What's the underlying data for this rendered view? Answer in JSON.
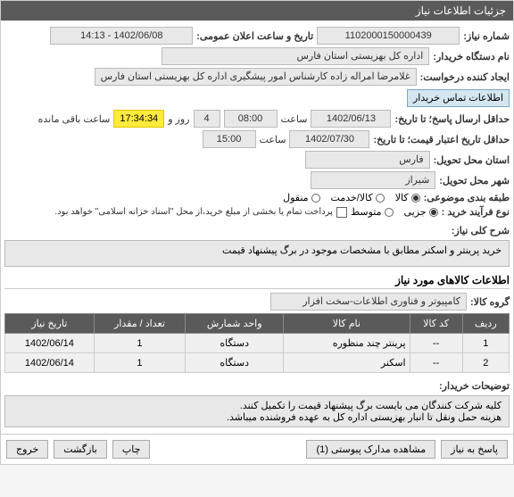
{
  "header": {
    "title": "جزئیات اطلاعات نیاز"
  },
  "fields": {
    "neednum_label": "شماره نیاز:",
    "neednum_value": "1102000150000439",
    "announce_label": "تاریخ و ساعت اعلان عمومی:",
    "announce_value": "1402/06/08 - 14:13",
    "buyerorg_label": "نام دستگاه خریدار:",
    "buyerorg_value": "اداره کل بهزیستی استان فارس",
    "requester_label": "ایجاد کننده درخواست:",
    "requester_value": "غلامرضا امراله زاده کارشناس امور پیشگیری اداره کل بهزیستی استان فارس",
    "contact_btn": "اطلاعات تماس خریدار",
    "deadline_label": "حداقل ارسال پاسخ؛ تا تاریخ:",
    "deadline_date": "1402/06/13",
    "time_label": "ساعت",
    "deadline_time": "08:00",
    "days_left": "4",
    "days_word": "روز و",
    "countdown": "17:34:34",
    "remaining": "ساعت باقی مانده",
    "validity_label": "حداقل تاریخ اعتبار قیمت؛ تا تاریخ:",
    "validity_date": "1402/07/30",
    "validity_time": "15:00",
    "province_label": "استان محل تحویل:",
    "province_value": "فارس",
    "city_label": "شهر محل تحویل:",
    "city_value": "شیراز",
    "category_label": "طبقه بندی موضوعی:",
    "cat_kala": "کالا",
    "cat_service": "کالا/خدمت",
    "cat_mix": "منقول",
    "process_label": "نوع فرآیند خرید :",
    "proc_partial": "جزیی",
    "proc_medium": "متوسط",
    "note_checkbox": "پرداخت تمام یا بخشی از مبلغ خرید،از محل \"اسناد خزانه اسلامی\" خواهد بود.",
    "maindesc_label": "شرح کلی نیاز:",
    "maindesc_value": "خرید پرینتر و اسکنر مطابق با مشخصات موجود در برگ پیشنهاد قیمت",
    "items_section": "اطلاعات کالاهای مورد نیاز",
    "grouplabel": "گروه کالا:",
    "groupvalue": "کامپیوتر و فناوری اطلاعات-سخت افزار",
    "buyernotes_label": "توضیحات خریدار:",
    "buyernotes_value": "کلیه شرکت کنندگان می بایست برگ پیشنهاد قیمت را تکمیل کنند.\nهزینه حمل ونقل تا انبار بهزیستی اداره کل به عهده فروشنده میباشد."
  },
  "table": {
    "headers": {
      "row": "ردیف",
      "code": "کد کالا",
      "name": "نام کالا",
      "unit": "واحد شمارش",
      "qty": "تعداد / مقدار",
      "date": "تاریخ نیاز"
    },
    "rows": [
      {
        "row": "1",
        "code": "--",
        "name": "پرینتر چند منظوره",
        "unit": "دستگاه",
        "qty": "1",
        "date": "1402/06/14"
      },
      {
        "row": "2",
        "code": "--",
        "name": "اسکنر",
        "unit": "دستگاه",
        "qty": "1",
        "date": "1402/06/14"
      }
    ]
  },
  "buttons": {
    "respond": "پاسخ به نیاز",
    "attachments": "مشاهده مدارک پیوستی (1)",
    "print": "چاپ",
    "back": "بازگشت",
    "exit": "خروج"
  }
}
